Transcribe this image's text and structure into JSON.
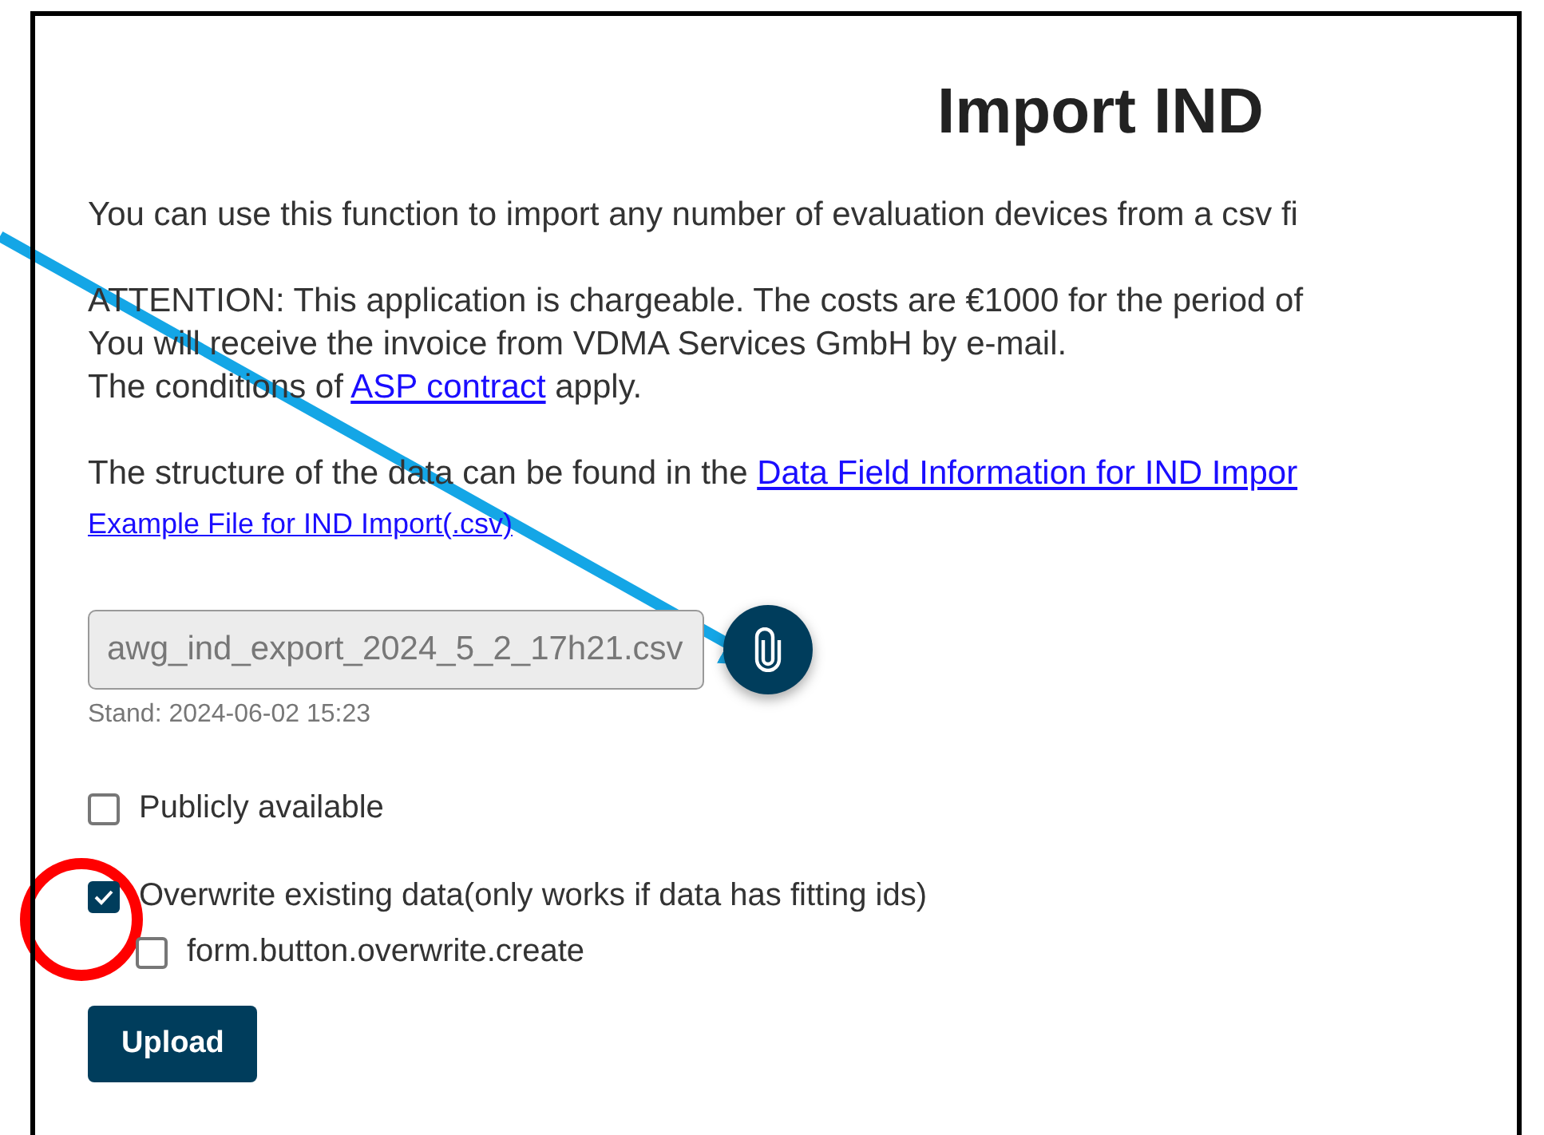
{
  "title": "Import IND",
  "intro": "You can use this function to import any number of evaluation devices from a csv fi",
  "attention": [
    {
      "text": "ATTENTION: This application is chargeable. The costs are €1000 for the period of"
    },
    {
      "text": "You will receive the invoice from VDMA Services GmbH by e-mail."
    },
    {
      "text": "The conditions of ",
      "link": "ASP contract",
      "after": " apply."
    }
  ],
  "structure": {
    "text": "The structure of the data can be found in the ",
    "link": "Data Field Information for IND Impor"
  },
  "example_link": "Example File for IND Import(.csv)",
  "file_field": {
    "value": "awg_ind_export_2024_5_2_17h21.csv",
    "note": "Stand: 2024-06-02 15:23"
  },
  "options": [
    {
      "label": "Publicly available",
      "checked": false
    },
    {
      "label": "Overwrite existing data(only works if data has fitting ids)",
      "checked": true,
      "children": [
        {
          "label": "form.button.overwrite.create",
          "checked": false
        }
      ]
    }
  ],
  "upload_button": "Upload"
}
